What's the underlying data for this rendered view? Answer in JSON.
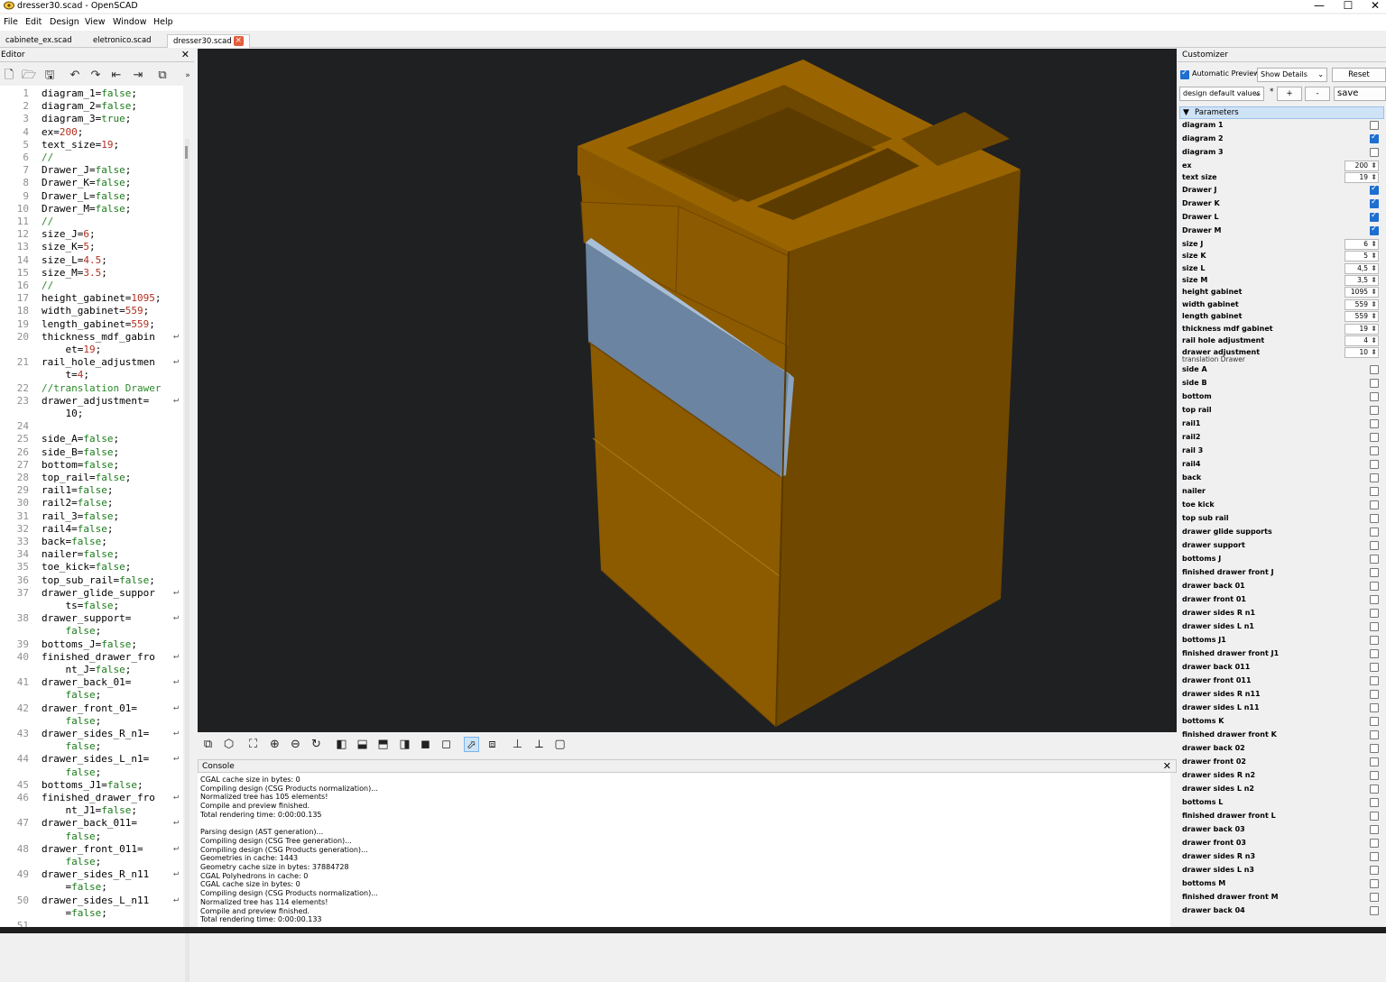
{
  "window": {
    "title": "dresser30.scad - OpenSCAD",
    "min": "—",
    "max": "☐",
    "close": "✕"
  },
  "menu": [
    "File",
    "Edit",
    "Design",
    "View",
    "Window",
    "Help"
  ],
  "tabs": [
    {
      "label": "cabinete_ex.scad",
      "active": false
    },
    {
      "label": "eletronico.scad",
      "active": false
    },
    {
      "label": "dresser30.scad",
      "active": true
    }
  ],
  "editor": {
    "title": "Editor",
    "close": "✕"
  },
  "code": [
    {
      "n": "1",
      "t": "diagram_1=false;"
    },
    {
      "n": "2",
      "t": "diagram_2=false;"
    },
    {
      "n": "3",
      "t": "diagram_3=true;"
    },
    {
      "n": "4",
      "t": "ex=200;"
    },
    {
      "n": "5",
      "t": "text_size=19;"
    },
    {
      "n": "6",
      "t": "//"
    },
    {
      "n": "7",
      "t": "Drawer_J=false;"
    },
    {
      "n": "8",
      "t": "Drawer_K=false;"
    },
    {
      "n": "9",
      "t": "Drawer_L=false;"
    },
    {
      "n": "10",
      "t": "Drawer_M=false;"
    },
    {
      "n": "11",
      "t": "//"
    },
    {
      "n": "12",
      "t": "size_J=6;"
    },
    {
      "n": "13",
      "t": "size_K=5;"
    },
    {
      "n": "14",
      "t": "size_L=4.5;"
    },
    {
      "n": "15",
      "t": "size_M=3.5;"
    },
    {
      "n": "16",
      "t": "//"
    },
    {
      "n": "17",
      "t": "height_gabinet=1095;"
    },
    {
      "n": "18",
      "t": "width_gabinet=559;"
    },
    {
      "n": "19",
      "t": "length_gabinet=559;"
    },
    {
      "n": "20",
      "t": "thickness_mdf_gabin",
      "w": "    et=19;"
    },
    {
      "n": "21",
      "t": "rail_hole_adjustmen",
      "w": "    t=4;"
    },
    {
      "n": "22",
      "t": "//translation Drawer"
    },
    {
      "n": "23",
      "t": "drawer_adjustment=",
      "w": "    10;"
    },
    {
      "n": "24",
      "t": ""
    },
    {
      "n": "25",
      "t": "side_A=false;"
    },
    {
      "n": "26",
      "t": "side_B=false;"
    },
    {
      "n": "27",
      "t": "bottom=false;"
    },
    {
      "n": "28",
      "t": "top_rail=false;"
    },
    {
      "n": "29",
      "t": "rail1=false;"
    },
    {
      "n": "30",
      "t": "rail2=false;"
    },
    {
      "n": "31",
      "t": "rail_3=false;"
    },
    {
      "n": "32",
      "t": "rail4=false;"
    },
    {
      "n": "33",
      "t": "back=false;"
    },
    {
      "n": "34",
      "t": "nailer=false;"
    },
    {
      "n": "35",
      "t": "toe_kick=false;"
    },
    {
      "n": "36",
      "t": "top_sub_rail=false;"
    },
    {
      "n": "37",
      "t": "drawer_glide_suppor",
      "w": "    ts=false;"
    },
    {
      "n": "38",
      "t": "drawer_support=",
      "w": "    false;"
    },
    {
      "n": "39",
      "t": "bottoms_J=false;"
    },
    {
      "n": "40",
      "t": "finished_drawer_fro",
      "w": "    nt_J=false;"
    },
    {
      "n": "41",
      "t": "drawer_back_01=",
      "w": "    false;"
    },
    {
      "n": "42",
      "t": "drawer_front_01=",
      "w": "    false;"
    },
    {
      "n": "43",
      "t": "drawer_sides_R_n1=",
      "w": "    false;"
    },
    {
      "n": "44",
      "t": "drawer_sides_L_n1=",
      "w": "    false;"
    },
    {
      "n": "45",
      "t": "bottoms_J1=false;"
    },
    {
      "n": "46",
      "t": "finished_drawer_fro",
      "w": "    nt_J1=false;"
    },
    {
      "n": "47",
      "t": "drawer_back_011=",
      "w": "    false;"
    },
    {
      "n": "48",
      "t": "drawer_front_011=",
      "w": "    false;"
    },
    {
      "n": "49",
      "t": "drawer_sides_R_n11",
      "w": "    =false;"
    },
    {
      "n": "50",
      "t": "drawer_sides_L_n11",
      "w": "    =false;"
    },
    {
      "n": "51",
      "t": ""
    }
  ],
  "console": {
    "title": "Console",
    "close": "✕",
    "lines": [
      "CGAL cache size in bytes: 0",
      "Compiling design (CSG Products normalization)...",
      "Normalized tree has 105 elements!",
      "Compile and preview finished.",
      "Total rendering time: 0:00:00.135",
      "",
      "Parsing design (AST generation)...",
      "Compiling design (CSG Tree generation)...",
      "Compiling design (CSG Products generation)...",
      "Geometries in cache: 1443",
      "Geometry cache size in bytes: 37884728",
      "CGAL Polyhedrons in cache: 0",
      "CGAL cache size in bytes: 0",
      "Compiling design (CSG Products normalization)...",
      "Normalized tree has 114 elements!",
      "Compile and preview finished.",
      "Total rendering time: 0:00:00.133"
    ]
  },
  "customizer": {
    "title": "Customizer",
    "auto_preview": "Automatic Preview",
    "show_details": "Show Details",
    "reset": "Reset",
    "preset": "design default values",
    "star": "*",
    "plus": "+",
    "minus": "-",
    "save_preset": "save prese",
    "section": "Parameters",
    "sublabel": "translation Drawer",
    "params": [
      {
        "label": "diagram 1",
        "type": "check",
        "on": false
      },
      {
        "label": "diagram 2",
        "type": "check",
        "on": true
      },
      {
        "label": "diagram 3",
        "type": "check",
        "on": false
      },
      {
        "label": "ex",
        "type": "num",
        "value": "200"
      },
      {
        "label": "text size",
        "type": "num",
        "value": "19"
      },
      {
        "label": "Drawer J",
        "type": "check",
        "on": true
      },
      {
        "label": "Drawer K",
        "type": "check",
        "on": true
      },
      {
        "label": "Drawer L",
        "type": "check",
        "on": true
      },
      {
        "label": "Drawer M",
        "type": "check",
        "on": true
      },
      {
        "label": "size J",
        "type": "num",
        "value": "6"
      },
      {
        "label": "size K",
        "type": "num",
        "value": "5"
      },
      {
        "label": "size L",
        "type": "num",
        "value": "4,5"
      },
      {
        "label": "size M",
        "type": "num",
        "value": "3,5"
      },
      {
        "label": "height gabinet",
        "type": "num",
        "value": "1095"
      },
      {
        "label": "width gabinet",
        "type": "num",
        "value": "559"
      },
      {
        "label": "length gabinet",
        "type": "num",
        "value": "559"
      },
      {
        "label": "thickness mdf gabinet",
        "type": "num",
        "value": "19"
      },
      {
        "label": "rail hole adjustment",
        "type": "num",
        "value": "4"
      },
      {
        "label": "drawer adjustment",
        "type": "num",
        "value": "10"
      },
      {
        "label": "side A",
        "type": "check",
        "on": false
      },
      {
        "label": "side B",
        "type": "check",
        "on": false
      },
      {
        "label": "bottom",
        "type": "check",
        "on": false
      },
      {
        "label": "top rail",
        "type": "check",
        "on": false
      },
      {
        "label": "rail1",
        "type": "check",
        "on": false
      },
      {
        "label": "rail2",
        "type": "check",
        "on": false
      },
      {
        "label": "rail 3",
        "type": "check",
        "on": false
      },
      {
        "label": "rail4",
        "type": "check",
        "on": false
      },
      {
        "label": "back",
        "type": "check",
        "on": false
      },
      {
        "label": "nailer",
        "type": "check",
        "on": false
      },
      {
        "label": "toe kick",
        "type": "check",
        "on": false
      },
      {
        "label": "top sub rail",
        "type": "check",
        "on": false
      },
      {
        "label": "drawer glide supports",
        "type": "check",
        "on": false
      },
      {
        "label": "drawer support",
        "type": "check",
        "on": false
      },
      {
        "label": "bottoms J",
        "type": "check",
        "on": false
      },
      {
        "label": "finished drawer front J",
        "type": "check",
        "on": false
      },
      {
        "label": "drawer back 01",
        "type": "check",
        "on": false
      },
      {
        "label": "drawer front 01",
        "type": "check",
        "on": false
      },
      {
        "label": "drawer sides R n1",
        "type": "check",
        "on": false
      },
      {
        "label": "drawer sides L n1",
        "type": "check",
        "on": false
      },
      {
        "label": "bottoms J1",
        "type": "check",
        "on": false
      },
      {
        "label": "finished drawer front J1",
        "type": "check",
        "on": false
      },
      {
        "label": "drawer back 011",
        "type": "check",
        "on": false
      },
      {
        "label": "drawer front 011",
        "type": "check",
        "on": false
      },
      {
        "label": "drawer sides R n11",
        "type": "check",
        "on": false
      },
      {
        "label": "drawer sides L n11",
        "type": "check",
        "on": false
      },
      {
        "label": "bottoms K",
        "type": "check",
        "on": false
      },
      {
        "label": "finished drawer front K",
        "type": "check",
        "on": false
      },
      {
        "label": "drawer back 02",
        "type": "check",
        "on": false
      },
      {
        "label": "drawer front 02",
        "type": "check",
        "on": false
      },
      {
        "label": "drawer sides R n2",
        "type": "check",
        "on": false
      },
      {
        "label": "drawer sides L n2",
        "type": "check",
        "on": false
      },
      {
        "label": "bottoms L",
        "type": "check",
        "on": false
      },
      {
        "label": "finished drawer front L",
        "type": "check",
        "on": false
      },
      {
        "label": "drawer back 03",
        "type": "check",
        "on": false
      },
      {
        "label": "drawer front 03",
        "type": "check",
        "on": false
      },
      {
        "label": "drawer sides R n3",
        "type": "check",
        "on": false
      },
      {
        "label": "drawer sides L n3",
        "type": "check",
        "on": false
      },
      {
        "label": "bottoms M",
        "type": "check",
        "on": false
      },
      {
        "label": "finished drawer front M",
        "type": "check",
        "on": false
      },
      {
        "label": "drawer back 04",
        "type": "check",
        "on": false
      }
    ]
  },
  "colors": {
    "viewport_bg": "#1f2022",
    "cabinet": "#8c5a00",
    "highlight": "#6b86a6",
    "accent": "#1e6fd0"
  }
}
